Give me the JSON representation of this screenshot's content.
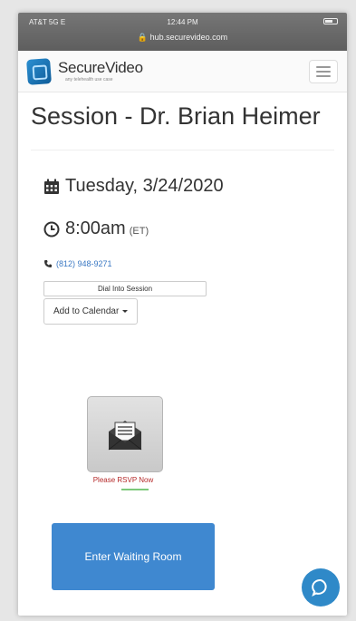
{
  "status_bar": {
    "carrier": "AT&T 5G E",
    "time": "12:44 PM",
    "url": "hub.securevideo.com"
  },
  "brand": {
    "name": "SecureVideo",
    "tagline": "any telehealth use case",
    "accent_color": "#1e7cc0"
  },
  "session": {
    "title": "Session - Dr. Brian Heimer",
    "date": "Tuesday, 3/24/2020",
    "time": "8:00am",
    "timezone": "(ET)",
    "phone": "(812) 948-9271"
  },
  "buttons": {
    "dial": "Dial Into Session",
    "calendar": "Add to Calendar",
    "rsvp": "Please RSVP Now",
    "enter": "Enter Waiting Room"
  },
  "colors": {
    "primary_button": "#3f88d0",
    "rsvp_text": "#b52a2a",
    "link": "#3a78c3"
  },
  "icons": [
    "calendar-icon",
    "clock-icon",
    "phone-icon",
    "envelope-icon",
    "chat-icon",
    "menu-icon",
    "lock-icon"
  ]
}
